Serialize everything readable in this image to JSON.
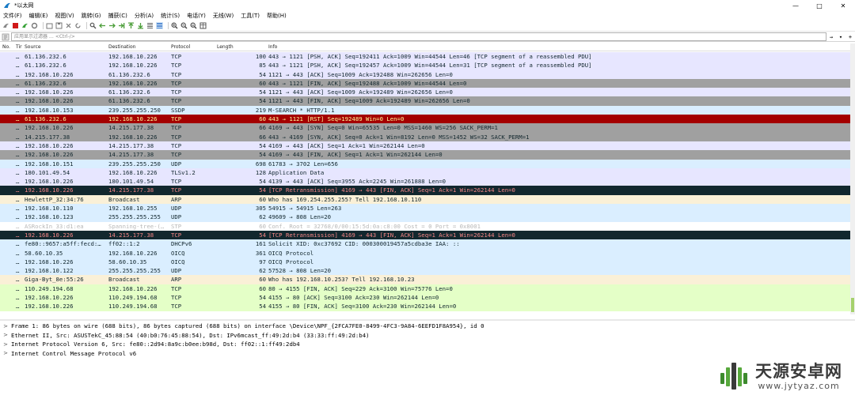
{
  "window": {
    "title": "*以太网",
    "controls": {
      "minimize": "—",
      "maximize": "□",
      "close": "✕"
    }
  },
  "menu": [
    "文件(F)",
    "编辑(E)",
    "视图(V)",
    "跳转(G)",
    "捕获(C)",
    "分析(A)",
    "统计(S)",
    "电话(Y)",
    "无线(W)",
    "工具(T)",
    "帮助(H)"
  ],
  "toolbar_icons": [
    "shark-fin-icon",
    "stop-icon",
    "restart-icon",
    "options-gear-icon",
    "open-folder-icon",
    "save-icon",
    "close-file-icon",
    "reload-icon",
    "find-icon",
    "back-arrow-icon",
    "forward-arrow-icon",
    "go-to-icon",
    "first-packet-icon",
    "last-packet-icon",
    "autoscroll-icon",
    "colorize-icon",
    "zoom-in-icon",
    "zoom-out-icon",
    "zoom-normal-icon",
    "resize-columns-icon"
  ],
  "filter": {
    "placeholder": "应用显示过滤器 … <Ctrl-/>",
    "arrow_button": "→",
    "dropdown_button": "▾",
    "add_button": "+"
  },
  "columns": [
    "No.",
    "Tir",
    "Source",
    "Destination",
    "Protocol",
    "Length",
    "Info"
  ],
  "colors": {
    "tcp": "#e7e6ff",
    "tcp_gray": "#a0a0a0",
    "rst": "#a40000",
    "bad": "#12272e",
    "udp": "#daeeff",
    "arp": "#faf0d7",
    "icmp_green": "#e4ffc7",
    "stp": "#ffffff"
  },
  "packets": [
    {
      "no": "…",
      "src": "61.136.232.6",
      "dst": "192.168.10.226",
      "proto": "TCP",
      "len": "100",
      "info": "443 → 1121 [PSH, ACK] Seq=192411 Ack=1009 Win=44544 Len=46 [TCP segment of a reassembled PDU]",
      "bg": "#e7e6ff",
      "fg": "#12272e"
    },
    {
      "no": "…",
      "src": "61.136.232.6",
      "dst": "192.168.10.226",
      "proto": "TCP",
      "len": "85",
      "info": "443 → 1121 [PSH, ACK] Seq=192457 Ack=1009 Win=44544 Len=31 [TCP segment of a reassembled PDU]",
      "bg": "#e7e6ff",
      "fg": "#12272e"
    },
    {
      "no": "…",
      "src": "192.168.10.226",
      "dst": "61.136.232.6",
      "proto": "TCP",
      "len": "54",
      "info": "1121 → 443 [ACK] Seq=1009 Ack=192488 Win=262656 Len=0",
      "bg": "#e7e6ff",
      "fg": "#12272e"
    },
    {
      "no": "…",
      "src": "61.136.232.6",
      "dst": "192.168.10.226",
      "proto": "TCP",
      "len": "60",
      "info": "443 → 1121 [FIN, ACK] Seq=192488 Ack=1009 Win=44544 Len=0",
      "bg": "#a0a0a0",
      "fg": "#12272e"
    },
    {
      "no": "…",
      "src": "192.168.10.226",
      "dst": "61.136.232.6",
      "proto": "TCP",
      "len": "54",
      "info": "1121 → 443 [ACK] Seq=1009 Ack=192489 Win=262656 Len=0",
      "bg": "#e7e6ff",
      "fg": "#12272e"
    },
    {
      "no": "…",
      "src": "192.168.10.226",
      "dst": "61.136.232.6",
      "proto": "TCP",
      "len": "54",
      "info": "1121 → 443 [FIN, ACK] Seq=1009 Ack=192489 Win=262656 Len=0",
      "bg": "#a0a0a0",
      "fg": "#12272e"
    },
    {
      "no": "…",
      "src": "192.168.10.153",
      "dst": "239.255.255.250",
      "proto": "SSDP",
      "len": "219",
      "info": "M-SEARCH * HTTP/1.1",
      "bg": "#daeeff",
      "fg": "#12272e"
    },
    {
      "no": "…",
      "src": "61.136.232.6",
      "dst": "192.168.10.226",
      "proto": "TCP",
      "len": "60",
      "info": "443 → 1121 [RST] Seq=192489 Win=0 Len=0",
      "bg": "#a40000",
      "fg": "#fffc9c"
    },
    {
      "no": "…",
      "src": "192.168.10.226",
      "dst": "14.215.177.38",
      "proto": "TCP",
      "len": "66",
      "info": "4169 → 443 [SYN] Seq=0 Win=65535 Len=0 MSS=1460 WS=256 SACK_PERM=1",
      "bg": "#a0a0a0",
      "fg": "#12272e"
    },
    {
      "no": "…",
      "src": "14.215.177.38",
      "dst": "192.168.10.226",
      "proto": "TCP",
      "len": "66",
      "info": "443 → 4169 [SYN, ACK] Seq=0 Ack=1 Win=8192 Len=0 MSS=1452 WS=32 SACK_PERM=1",
      "bg": "#a0a0a0",
      "fg": "#12272e"
    },
    {
      "no": "…",
      "src": "192.168.10.226",
      "dst": "14.215.177.38",
      "proto": "TCP",
      "len": "54",
      "info": "4169 → 443 [ACK] Seq=1 Ack=1 Win=262144 Len=0",
      "bg": "#e7e6ff",
      "fg": "#12272e"
    },
    {
      "no": "…",
      "src": "192.168.10.226",
      "dst": "14.215.177.38",
      "proto": "TCP",
      "len": "54",
      "info": "4169 → 443 [FIN, ACK] Seq=1 Ack=1 Win=262144 Len=0",
      "bg": "#a0a0a0",
      "fg": "#12272e"
    },
    {
      "no": "…",
      "src": "192.168.10.151",
      "dst": "239.255.255.250",
      "proto": "UDP",
      "len": "698",
      "info": "61783 → 3702 Len=656",
      "bg": "#daeeff",
      "fg": "#12272e"
    },
    {
      "no": "…",
      "src": "180.101.49.54",
      "dst": "192.168.10.226",
      "proto": "TLSv1.2",
      "len": "128",
      "info": "Application Data",
      "bg": "#e7e6ff",
      "fg": "#12272e"
    },
    {
      "no": "…",
      "src": "192.168.10.226",
      "dst": "180.101.49.54",
      "proto": "TCP",
      "len": "54",
      "info": "4139 → 443 [ACK] Seq=3955 Ack=2245 Win=261888 Len=0",
      "bg": "#e7e6ff",
      "fg": "#12272e"
    },
    {
      "no": "…",
      "src": "192.168.10.226",
      "dst": "14.215.177.38",
      "proto": "TCP",
      "len": "54",
      "info": "[TCP Retransmission] 4169 → 443 [FIN, ACK] Seq=1 Ack=1 Win=262144 Len=0",
      "bg": "#12272e",
      "fg": "#f78787"
    },
    {
      "no": "…",
      "src": "HewlettP_32:34:76",
      "dst": "Broadcast",
      "proto": "ARP",
      "len": "60",
      "info": "Who has 169.254.255.255? Tell 192.168.10.110",
      "bg": "#faf0d7",
      "fg": "#12272e"
    },
    {
      "no": "…",
      "src": "192.168.10.110",
      "dst": "192.168.10.255",
      "proto": "UDP",
      "len": "305",
      "info": "54915 → 54915 Len=263",
      "bg": "#daeeff",
      "fg": "#12272e"
    },
    {
      "no": "…",
      "src": "192.168.10.123",
      "dst": "255.255.255.255",
      "proto": "UDP",
      "len": "62",
      "info": "49609 → 808 Len=20",
      "bg": "#daeeff",
      "fg": "#12272e"
    },
    {
      "no": "…",
      "src": "ASRockIn_33:d1:ea",
      "dst": "Spanning-tree-(…",
      "proto": "STP",
      "len": "60",
      "info": "Conf. Root = 32768/0/00:15:5d:0a:c8:00  Cost = 0  Port = 0x8001",
      "bg": "#ffffff",
      "fg": "#b8b8b8"
    },
    {
      "no": "…",
      "src": "192.168.10.226",
      "dst": "14.215.177.38",
      "proto": "TCP",
      "len": "54",
      "info": "[TCP Retransmission] 4169 → 443 [FIN, ACK] Seq=1 Ack=1 Win=262144 Len=0",
      "bg": "#12272e",
      "fg": "#f78787"
    },
    {
      "no": "…",
      "src": "fe80::9657:a5ff:fecd:…",
      "dst": "ff02::1:2",
      "proto": "DHCPv6",
      "len": "161",
      "info": "Solicit XID: 0xc37692 CID: 000300019457a5cdba3e IAA: ::",
      "bg": "#daeeff",
      "fg": "#12272e"
    },
    {
      "no": "…",
      "src": "58.60.10.35",
      "dst": "192.168.10.226",
      "proto": "OICQ",
      "len": "361",
      "info": "OICQ Protocol",
      "bg": "#daeeff",
      "fg": "#12272e"
    },
    {
      "no": "…",
      "src": "192.168.10.226",
      "dst": "58.60.10.35",
      "proto": "OICQ",
      "len": "97",
      "info": "OICQ Protocol",
      "bg": "#daeeff",
      "fg": "#12272e"
    },
    {
      "no": "…",
      "src": "192.168.10.122",
      "dst": "255.255.255.255",
      "proto": "UDP",
      "len": "62",
      "info": "57528 → 808 Len=20",
      "bg": "#daeeff",
      "fg": "#12272e"
    },
    {
      "no": "…",
      "src": "Giga-Byt_8e:55:26",
      "dst": "Broadcast",
      "proto": "ARP",
      "len": "60",
      "info": "Who has 192.168.10.253? Tell 192.168.10.23",
      "bg": "#faf0d7",
      "fg": "#12272e"
    },
    {
      "no": "…",
      "src": "110.249.194.68",
      "dst": "192.168.10.226",
      "proto": "TCP",
      "len": "60",
      "info": "80 → 4155 [FIN, ACK] Seq=229 Ack=3100 Win=75776 Len=0",
      "bg": "#e4ffc7",
      "fg": "#12272e"
    },
    {
      "no": "…",
      "src": "192.168.10.226",
      "dst": "110.249.194.68",
      "proto": "TCP",
      "len": "54",
      "info": "4155 → 80 [ACK] Seq=3100 Ack=230 Win=262144 Len=0",
      "bg": "#e4ffc7",
      "fg": "#12272e"
    },
    {
      "no": "…",
      "src": "192.168.10.226",
      "dst": "110.249.194.68",
      "proto": "TCP",
      "len": "54",
      "info": "4155 → 80 [FIN, ACK] Seq=3100 Ack=230 Win=262144 Len=0",
      "bg": "#e4ffc7",
      "fg": "#12272e"
    }
  ],
  "details": [
    "Frame 1: 86 bytes on wire (688 bits), 86 bytes captured (688 bits) on interface \\Device\\NPF_{2FCA7FE0-8499-4FC3-9A84-6EEFD1F8A954}, id 0",
    "Ethernet II, Src: ASUSTekC_45:88:54 (40:b0:76:45:88:54), Dst: IPv6mcast_ff:49:2d:b4 (33:33:ff:49:2d:b4)",
    "Internet Protocol Version 6, Src: fe80::2d94:8a9c:b0ee:b98d, Dst: ff02::1:ff49:2db4",
    "Internet Control Message Protocol v6"
  ],
  "details_arrow": ">",
  "watermark": {
    "name": "天源安卓网",
    "url": "www.jytyaz.com"
  }
}
